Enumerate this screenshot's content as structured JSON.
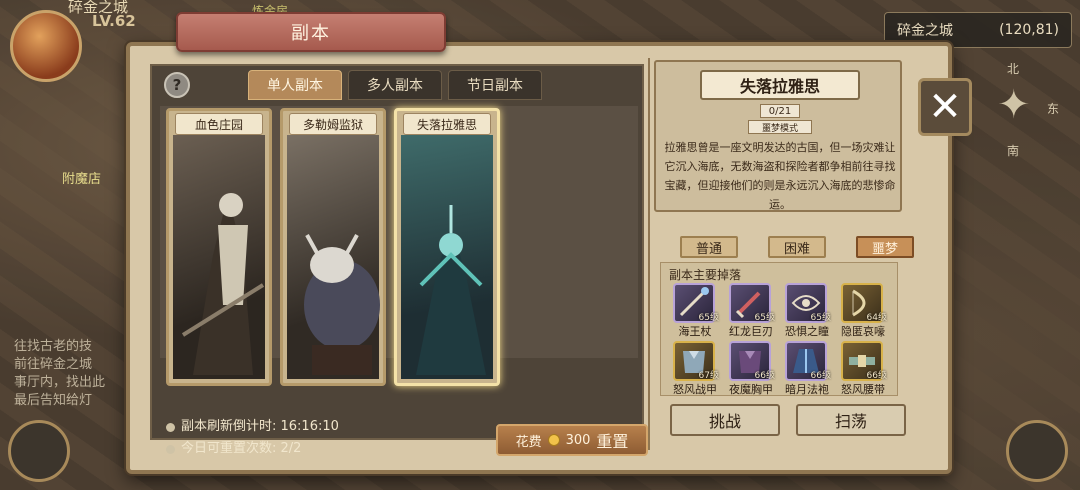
{
  "hud": {
    "top_left_title": "碎金之城",
    "level": "LV.62",
    "building_label": "炼金房",
    "location_name": "碎金之城",
    "location_coords": "(120,81)",
    "compass": {
      "north": "北",
      "east": "东",
      "south": "南"
    },
    "side_label": "附魔店",
    "side_text": [
      "往找古老的技",
      "前往碎金之城",
      "事厅内，找出此",
      "最后告知给灯"
    ]
  },
  "panel": {
    "title": "副本",
    "close_label": "✕",
    "help_label": "?",
    "tabs": [
      {
        "label": "单人副本",
        "active": true
      },
      {
        "label": "多人副本",
        "active": false
      },
      {
        "label": "节日副本",
        "active": false
      }
    ],
    "dungeons": [
      {
        "label": "血色庄园",
        "selected": false
      },
      {
        "label": "多勒姆监狱",
        "selected": false
      },
      {
        "label": "失落拉雅思",
        "selected": true
      }
    ],
    "refresh_label": "副本刷新倒计时: 16:16:10",
    "reset_count_label": "今日可重置次数: 2/2",
    "reset_button": {
      "cost_prefix": "花费",
      "cost": "300",
      "action": "重置"
    }
  },
  "detail": {
    "name": "失落拉雅思",
    "progress": "0/21",
    "mode": "噩梦模式",
    "description": "拉雅思曾是一座文明发达的古国，但一场灾难让它沉入海底，无数海盗和探险者都争相前往寻找宝藏，但迎接他们的则是永远沉入海底的悲惨命运。",
    "difficulties": [
      {
        "label": "普通",
        "active": false
      },
      {
        "label": "困难",
        "active": false
      },
      {
        "label": "噩梦",
        "active": true
      }
    ],
    "drops_title": "副本主要掉落",
    "drops": [
      {
        "name": "海王杖",
        "level": "65级",
        "rarity": "purple",
        "icon": "staff-icon"
      },
      {
        "name": "红龙巨刃",
        "level": "65级",
        "rarity": "purple",
        "icon": "sword-icon"
      },
      {
        "name": "恐惧之瞳",
        "level": "65级",
        "rarity": "purple",
        "icon": "eye-icon"
      },
      {
        "name": "隐匿哀嚎",
        "level": "64级",
        "rarity": "gold",
        "icon": "bow-icon"
      },
      {
        "name": "怒风战甲",
        "level": "67级",
        "rarity": "gold",
        "icon": "armor-icon"
      },
      {
        "name": "夜魔胸甲",
        "level": "66级",
        "rarity": "purple",
        "icon": "armor-icon"
      },
      {
        "name": "暗月法袍",
        "level": "66级",
        "rarity": "purple",
        "icon": "robe-icon"
      },
      {
        "name": "怒风腰带",
        "level": "66级",
        "rarity": "gold",
        "icon": "belt-icon"
      }
    ],
    "challenge_label": "挑战",
    "sweep_label": "扫荡"
  }
}
